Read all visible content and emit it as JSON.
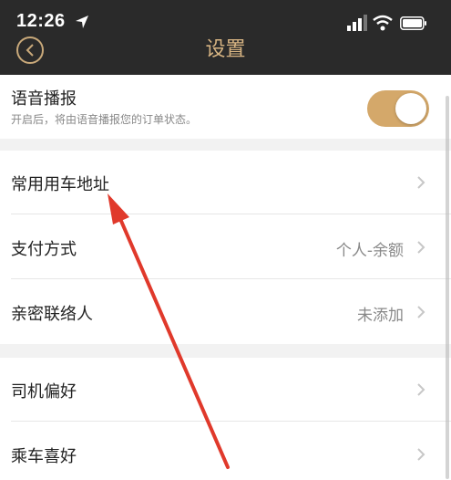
{
  "status_bar": {
    "time": "12:26"
  },
  "nav": {
    "title": "设置"
  },
  "voice": {
    "title": "语音播报",
    "description": "开启后，将由语音播报您的订单状态。",
    "enabled": true
  },
  "settings": {
    "group1": [
      {
        "label": "常用用车地址",
        "value": ""
      },
      {
        "label": "支付方式",
        "value": "个人-余额"
      },
      {
        "label": "亲密联络人",
        "value": "未添加"
      }
    ],
    "group2": [
      {
        "label": "司机偏好",
        "value": ""
      },
      {
        "label": "乘车喜好",
        "value": ""
      }
    ]
  },
  "colors": {
    "header": "#2a2a2a",
    "accent": "#d4a86a",
    "annotation_arrow": "#e0392b"
  },
  "icons": [
    "location-arrow-icon",
    "signal-icon",
    "wifi-icon",
    "battery-icon",
    "back-chevron-icon",
    "chevron-right-icon"
  ]
}
